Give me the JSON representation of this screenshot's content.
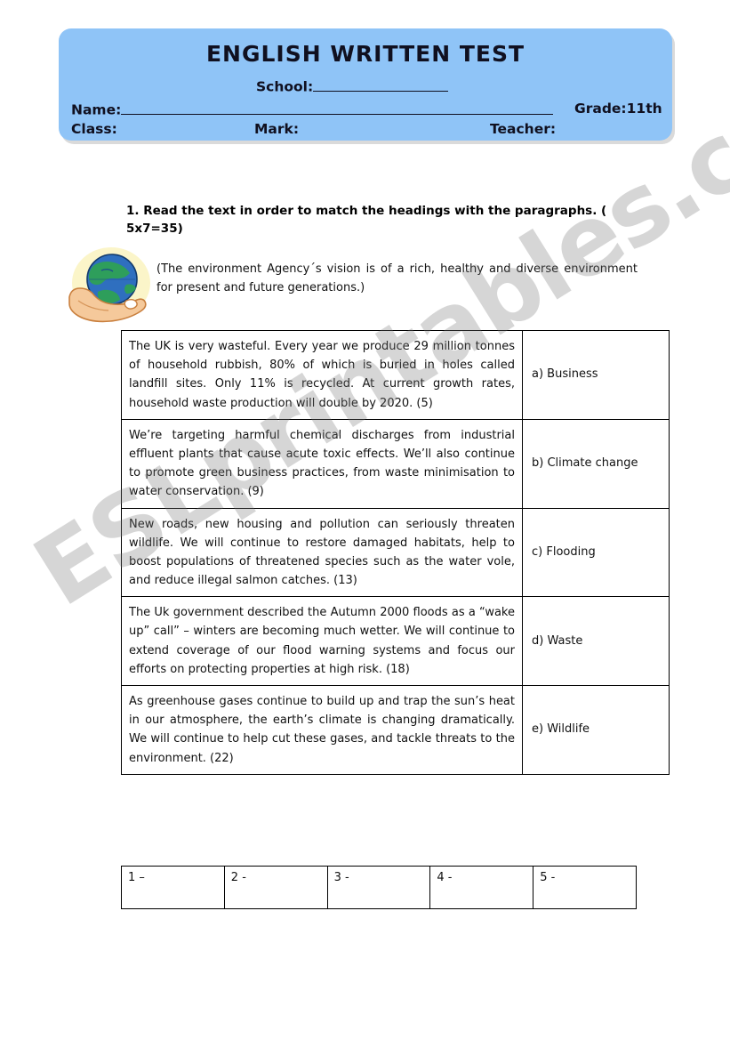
{
  "header": {
    "title": "ENGLISH WRITTEN TEST",
    "school_label": "School:",
    "name_label": "Name:",
    "grade_label": "Grade:11th",
    "class_label": "Class:",
    "mark_label": "Mark:",
    "teacher_label": "Teacher:",
    "bg_color": "#8FC4F7"
  },
  "exercise": {
    "instruction": "1.  Read the text in order to match the headings with the paragraphs. ( 5x7=35)",
    "intro": "(The environment Agency´s vision is of a rich, healthy and diverse environment for present and future generations.)"
  },
  "match_table": {
    "rows": [
      {
        "paragraph": "The UK is very wasteful. Every year we produce 29 million tonnes of household rubbish, 80% of which is buried in holes called landfill sites. Only 11% is recycled. At current growth rates, household waste production will double by 2020.  (5)",
        "heading": "a) Business"
      },
      {
        "paragraph": "We’re targeting harmful chemical discharges from industrial effluent plants that cause acute toxic effects. We’ll also continue to promote green business practices, from waste minimisation to water conservation. (9)",
        "heading": "b) Climate change"
      },
      {
        "paragraph": "New roads, new housing and pollution can seriously threaten wildlife. We will continue to restore damaged habitats, help to boost populations of threatened species such as the water vole, and reduce illegal salmon catches. (13)",
        "heading": "c) Flooding"
      },
      {
        "paragraph": "The Uk government described the Autumn 2000 floods as a “wake up” call” – winters are becoming much wetter. We will continue to extend coverage of our flood warning systems and focus our efforts on protecting properties at high risk. (18)",
        "heading": "d) Waste"
      },
      {
        "paragraph": "As greenhouse gases continue to build up and trap the sun’s heat in our atmosphere, the earth’s climate is changing dramatically. We will continue to help cut these gases, and tackle threats to the environment. (22)",
        "heading": "e) Wildlife"
      }
    ]
  },
  "answer_table": {
    "cells": [
      "1 –",
      "2 -",
      "3 -",
      "4 -",
      "5 -"
    ]
  },
  "watermark": {
    "text": "ESLprintables.com"
  }
}
